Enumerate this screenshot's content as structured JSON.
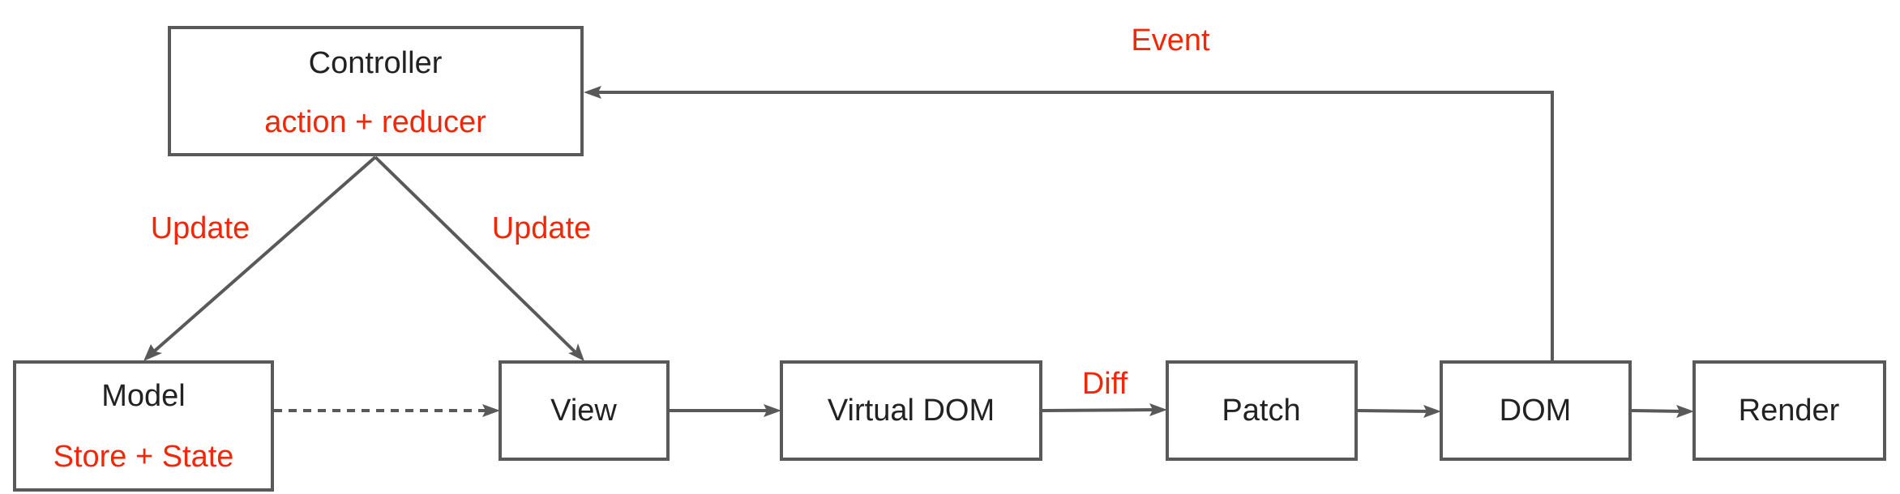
{
  "nodes": {
    "controller": {
      "title": "Controller",
      "subtitle": "action + reducer"
    },
    "model": {
      "title": "Model",
      "subtitle": "Store + State"
    },
    "view": {
      "title": "View"
    },
    "virtual_dom": {
      "title": "Virtual DOM"
    },
    "patch": {
      "title": "Patch"
    },
    "dom": {
      "title": "DOM"
    },
    "render": {
      "title": "Render"
    }
  },
  "edges": {
    "controller_to_model": {
      "label": "Update"
    },
    "controller_to_view": {
      "label": "Update"
    },
    "model_to_view": {
      "label": "",
      "style": "dashed"
    },
    "view_to_virtual_dom": {
      "label": ""
    },
    "virtual_dom_to_patch": {
      "label": "Diff"
    },
    "patch_to_dom": {
      "label": ""
    },
    "dom_to_render": {
      "label": ""
    },
    "dom_to_controller": {
      "label": "Event"
    }
  },
  "colors": {
    "text": "#222222",
    "label": "#f0280a",
    "stroke": "#595959"
  }
}
